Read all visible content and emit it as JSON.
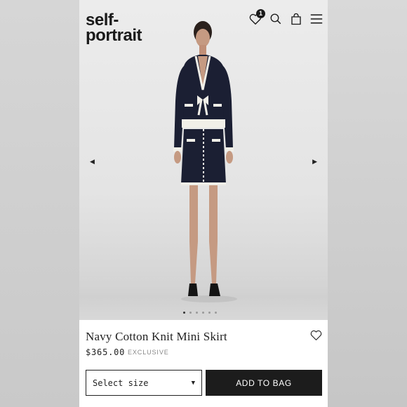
{
  "brand": {
    "line1": "self-",
    "line2": "portrait"
  },
  "header": {
    "wishlist_count": "1",
    "icons": [
      "heart-icon",
      "search-icon",
      "bag-icon",
      "menu-icon"
    ]
  },
  "gallery": {
    "prev_glyph": "◀",
    "next_glyph": "▶",
    "image_count": 6,
    "active_index": 0
  },
  "product": {
    "title": "Navy Cotton Knit Mini Skirt",
    "price": "$365.00",
    "tag": "EXCLUSIVE"
  },
  "actions": {
    "size_select": "Select size",
    "caret": "▼",
    "add_to_bag": "ADD TO BAG"
  },
  "colors": {
    "navy": "#1b1f33",
    "trim": "#f1efe8",
    "button": "#1c1c1c"
  }
}
